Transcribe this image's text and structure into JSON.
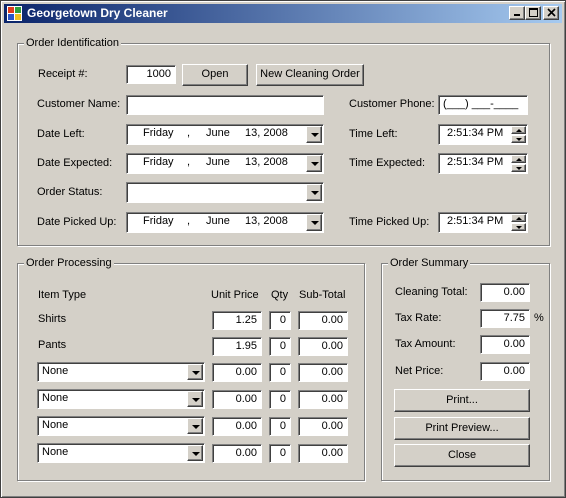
{
  "window": {
    "title": "Georgetown Dry Cleaner"
  },
  "order_identification": {
    "group_title": "Order Identification",
    "receipt_label": "Receipt #:",
    "receipt_value": "1000",
    "open_button": "Open",
    "new_order_button": "New Cleaning Order",
    "customer_name_label": "Customer Name:",
    "customer_name_value": "",
    "customer_phone_label": "Customer Phone:",
    "customer_phone_value": "(___) ___-____",
    "date_left_label": "Date Left:",
    "date_left": {
      "day": "Friday",
      "sep": ",",
      "month": "June",
      "date": "13, 2008"
    },
    "time_left_label": "Time Left:",
    "time_left_value": "2:51:34 PM",
    "date_expected_label": "Date Expected:",
    "date_expected": {
      "day": "Friday",
      "sep": ",",
      "month": "June",
      "date": "13, 2008"
    },
    "time_expected_label": "Time Expected:",
    "time_expected_value": "2:51:34 PM",
    "order_status_label": "Order Status:",
    "order_status_value": "",
    "date_picked_up_label": "Date Picked Up:",
    "date_picked_up": {
      "day": "Friday",
      "sep": ",",
      "month": "June",
      "date": "13, 2008"
    },
    "time_picked_up_label": "Time Picked Up:",
    "time_picked_up_value": "2:51:34 PM"
  },
  "order_processing": {
    "group_title": "Order Processing",
    "headers": {
      "item_type": "Item Type",
      "unit_price": "Unit Price",
      "qty": "Qty",
      "sub_total": "Sub-Total"
    },
    "rows": [
      {
        "item": "Shirts",
        "unit_price": "1.25",
        "qty": "0",
        "sub_total": "0.00"
      },
      {
        "item": "Pants",
        "unit_price": "1.95",
        "qty": "0",
        "sub_total": "0.00"
      },
      {
        "item": "None",
        "unit_price": "0.00",
        "qty": "0",
        "sub_total": "0.00"
      },
      {
        "item": "None",
        "unit_price": "0.00",
        "qty": "0",
        "sub_total": "0.00"
      },
      {
        "item": "None",
        "unit_price": "0.00",
        "qty": "0",
        "sub_total": "0.00"
      },
      {
        "item": "None",
        "unit_price": "0.00",
        "qty": "0",
        "sub_total": "0.00"
      }
    ]
  },
  "order_summary": {
    "group_title": "Order Summary",
    "cleaning_total_label": "Cleaning Total:",
    "cleaning_total_value": "0.00",
    "tax_rate_label": "Tax Rate:",
    "tax_rate_value": "7.75",
    "tax_rate_unit": "%",
    "tax_amount_label": "Tax Amount:",
    "tax_amount_value": "0.00",
    "net_price_label": "Net Price:",
    "net_price_value": "0.00",
    "print_button": "Print...",
    "print_preview_button": "Print Preview...",
    "close_button": "Close"
  }
}
